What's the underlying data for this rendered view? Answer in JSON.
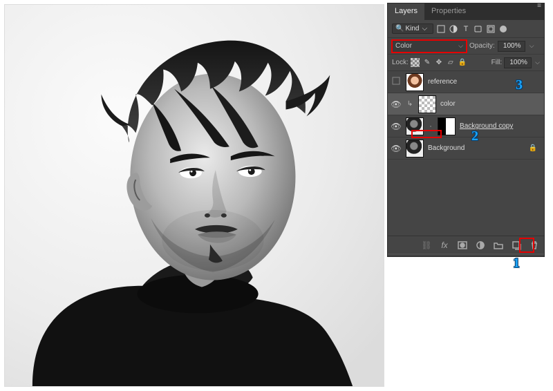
{
  "panel": {
    "tabs": {
      "active": "Layers",
      "other": "Properties"
    },
    "filter": {
      "kind_label": "Kind"
    },
    "blend": {
      "mode": "Color",
      "opacity_label": "Opacity:",
      "opacity_value": "100%"
    },
    "lock": {
      "label": "Lock:",
      "fill_label": "Fill:",
      "fill_value": "100%"
    },
    "layers": [
      {
        "id": "reference",
        "name": "reference",
        "visible": false,
        "type": "ref"
      },
      {
        "id": "color",
        "name": "color",
        "visible": true,
        "type": "trans",
        "selected": true,
        "clipped": true
      },
      {
        "id": "bgcopy",
        "name": "Background copy",
        "visible": true,
        "type": "masked",
        "underline": true
      },
      {
        "id": "bg",
        "name": "Background",
        "visible": true,
        "type": "bw",
        "locked": true
      }
    ],
    "bottom_icons": [
      "link",
      "fx",
      "mask",
      "adjust",
      "group",
      "new",
      "trash"
    ]
  },
  "annotations": {
    "a1": "1",
    "a2": "2",
    "a3": "3"
  }
}
